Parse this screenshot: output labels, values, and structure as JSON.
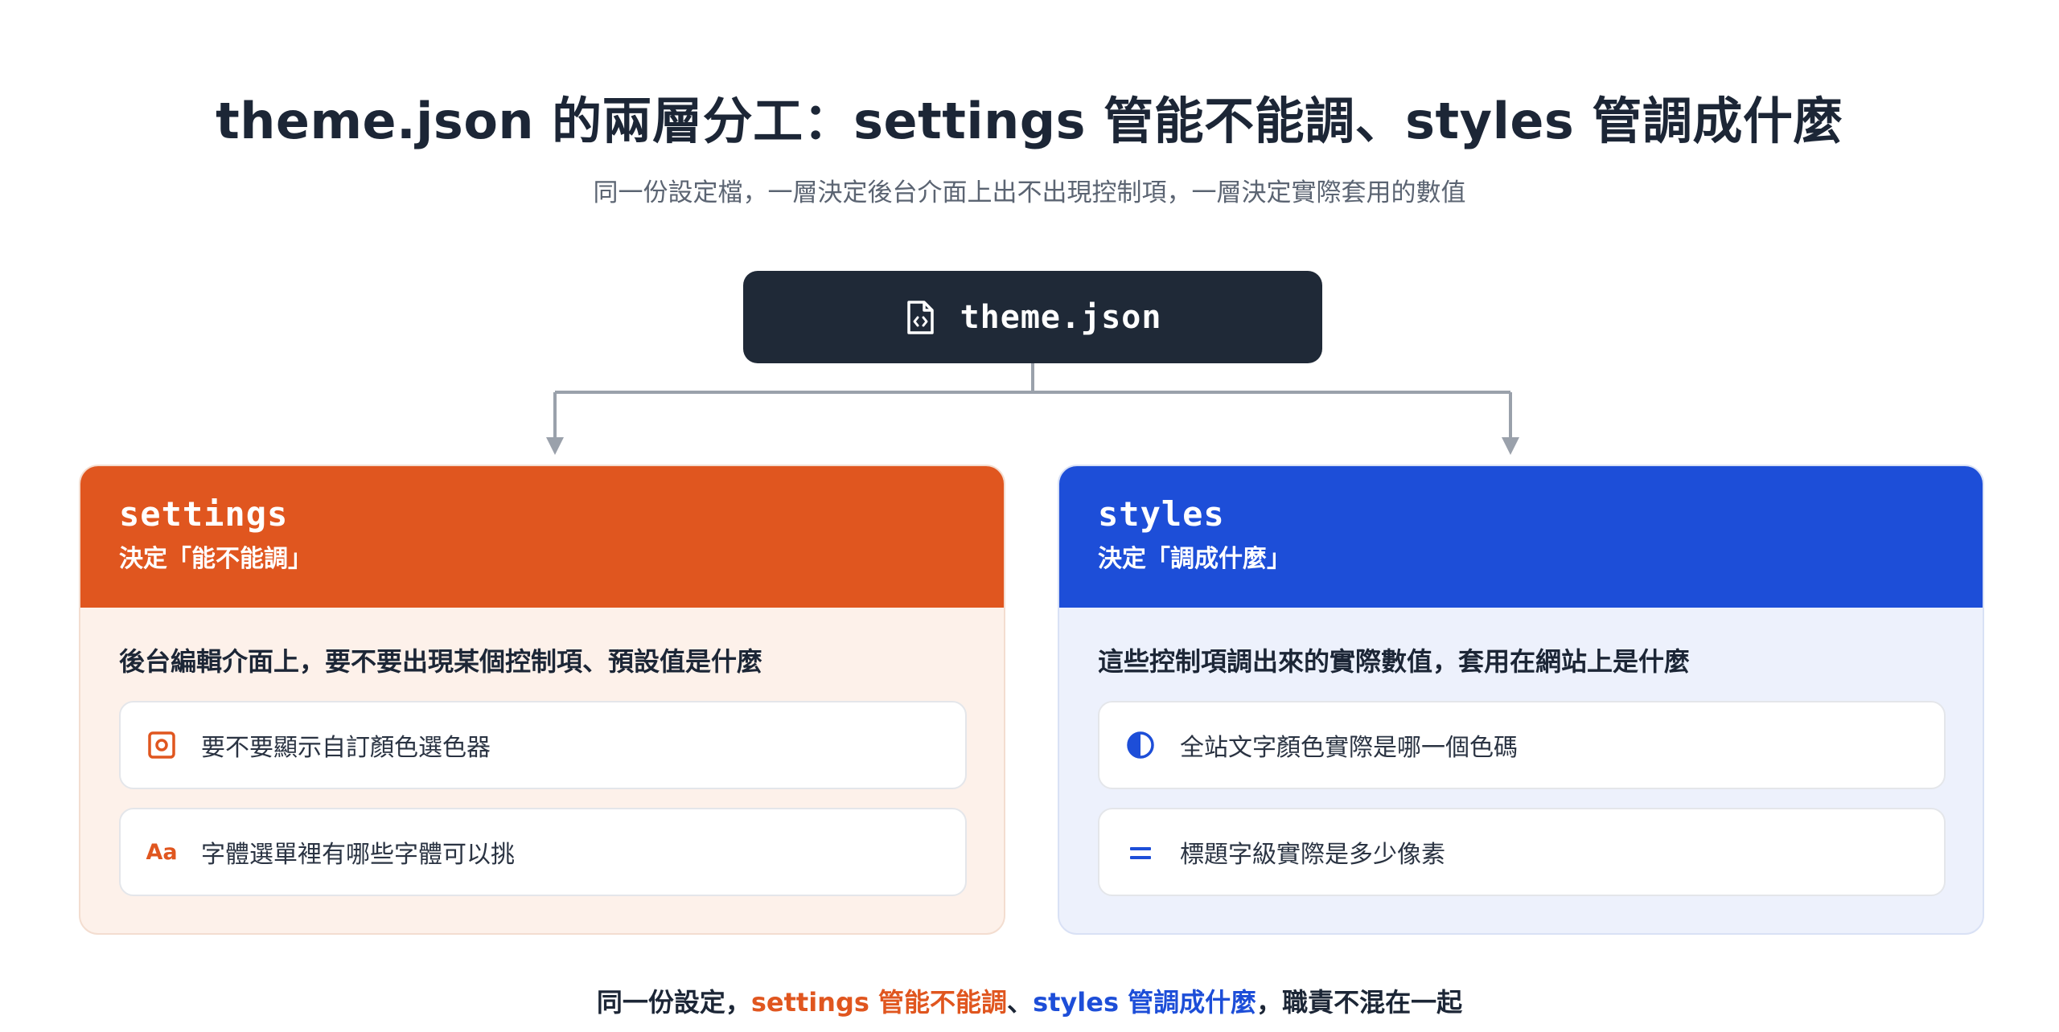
{
  "header": {
    "title": "theme.json 的兩層分工：settings 管能不能調、styles 管調成什麼",
    "subtitle": "同一份設定檔，一層決定後台介面上出不出現控制項，一層決定實際套用的數值"
  },
  "root": {
    "icon": "file-code-icon",
    "label": "theme.json"
  },
  "cards": {
    "settings": {
      "key": "settings",
      "role": "決定「能不能調」",
      "description": "後台編輯介面上，要不要出現某個控制項、預設值是什麼",
      "accent": "#e0561f",
      "items": [
        {
          "icon": "color-picker-icon",
          "label": "要不要顯示自訂顏色選色器"
        },
        {
          "icon": "font-aa-icon",
          "icon_text": "Aa",
          "label": "字體選單裡有哪些字體可以挑"
        }
      ]
    },
    "styles": {
      "key": "styles",
      "role": "決定「調成什麼」",
      "description": "這些控制項調出來的實際數值，套用在網站上是什麼",
      "accent": "#1d4ed8",
      "items": [
        {
          "icon": "contrast-half-circle-icon",
          "label": "全站文字顏色實際是哪一個色碼"
        },
        {
          "icon": "heading-lines-icon",
          "label": "標題字級實際是多少像素"
        }
      ]
    }
  },
  "footer": {
    "prefix": "同一份設定，",
    "settings_part": "settings 管能不能調",
    "separator": "、",
    "styles_part": "styles 管調成什麼",
    "suffix": "，職責不混在一起"
  },
  "colors": {
    "dark_node": "#1f2937",
    "settings_accent": "#e0561f",
    "styles_accent": "#1d4ed8",
    "connector": "#9aa1ab"
  }
}
